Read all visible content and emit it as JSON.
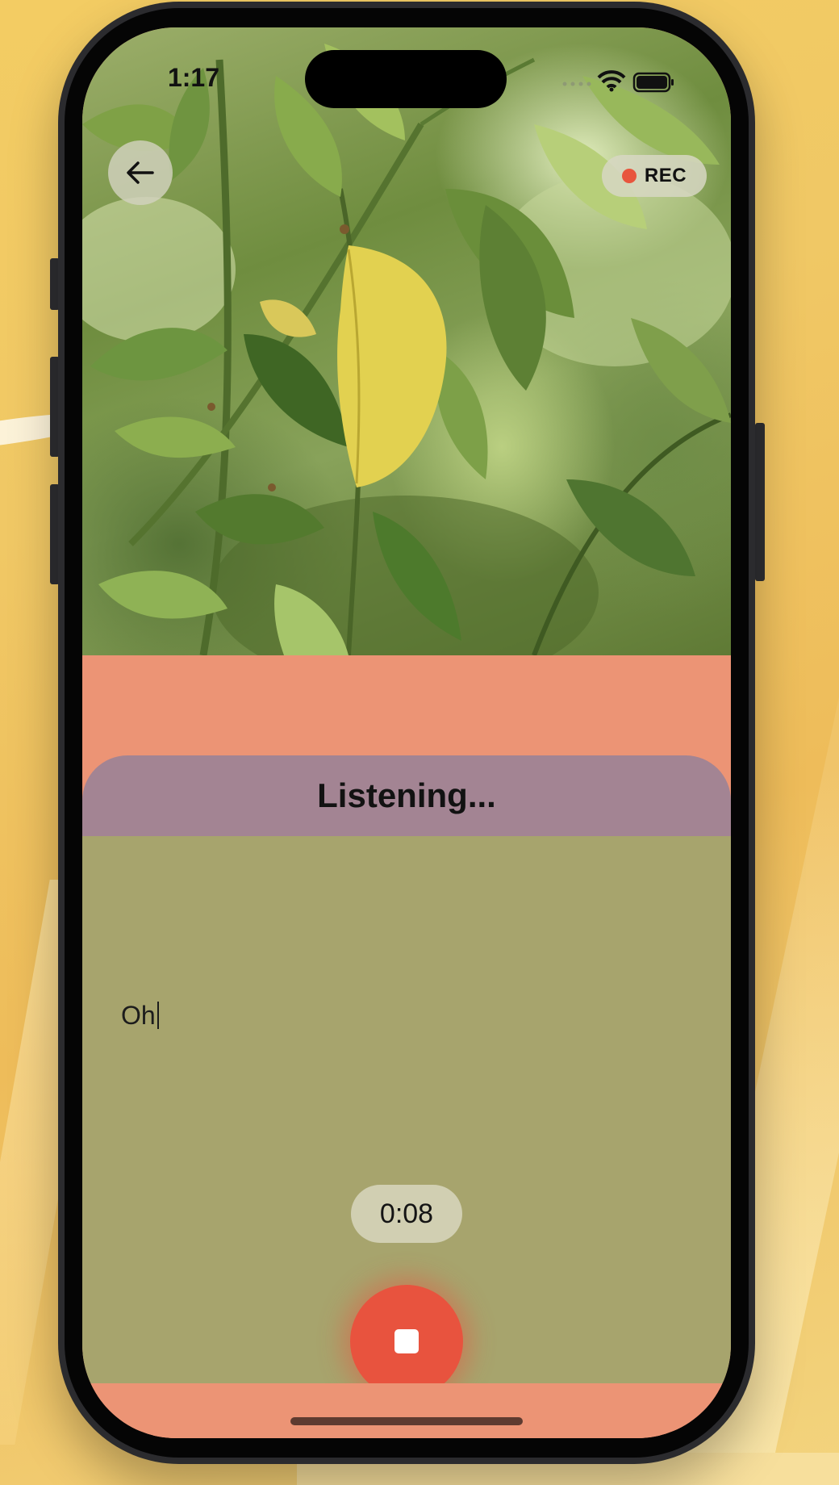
{
  "status_bar": {
    "time": "1:17",
    "icons": [
      "wifi-icon",
      "battery-icon"
    ]
  },
  "top_bar": {
    "back_icon": "arrow-left-icon",
    "recording_badge": "REC"
  },
  "sheet": {
    "title": "Listening...",
    "transcript": "Oh"
  },
  "controls": {
    "elapsed_time": "0:08",
    "stop_icon": "stop-icon"
  },
  "colors": {
    "accent_stop": "#e8533e",
    "rec_dot": "#e8553d",
    "sheet_header": "#a38493",
    "sheet_body": "#a7a46d",
    "salmon_band": "#ec9475"
  }
}
